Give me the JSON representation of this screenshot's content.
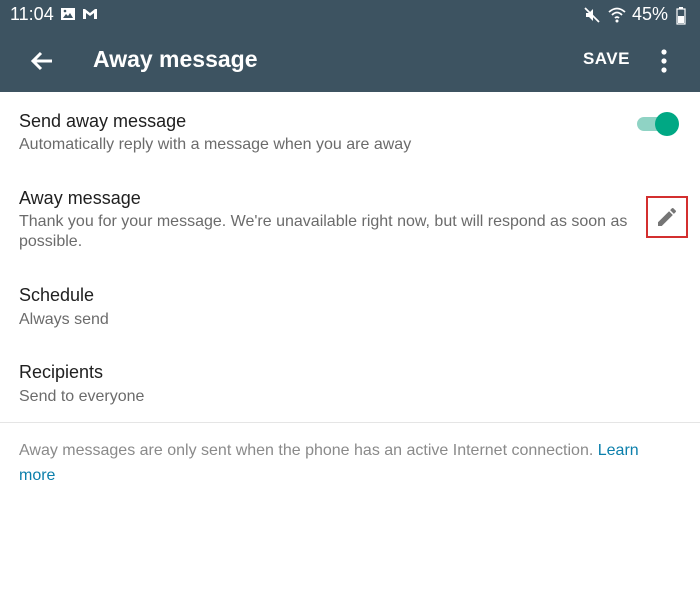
{
  "status_bar": {
    "time": "11:04",
    "battery": "45%",
    "left_icons": [
      "image-icon",
      "gmail-icon"
    ],
    "right_icons": [
      "mute-icon",
      "wifi-icon",
      "battery-icon"
    ]
  },
  "app_bar": {
    "title": "Away message",
    "save_label": "SAVE",
    "background": "#3d5361"
  },
  "settings": {
    "send_away": {
      "title": "Send away message",
      "subtitle": "Automatically reply with a message when you are away",
      "enabled": true
    },
    "away_message": {
      "title": "Away message",
      "subtitle": "Thank you for your message. We're unavailable right now, but will respond as soon as possible."
    },
    "schedule": {
      "title": "Schedule",
      "subtitle": "Always send"
    },
    "recipients": {
      "title": "Recipients",
      "subtitle": "Send to everyone"
    }
  },
  "footer": {
    "note": "Away messages are only sent when the phone has an active Internet connection.",
    "link_label": "Learn more"
  },
  "colors": {
    "accent": "#00a884",
    "link": "#0b7fab",
    "highlight_border": "#d32f2f"
  }
}
